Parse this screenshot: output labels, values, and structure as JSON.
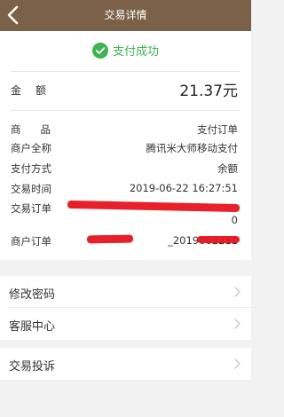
{
  "nav": {
    "title": "交易详情"
  },
  "status": {
    "text": "支付成功"
  },
  "amount": {
    "label": "金额",
    "value": "21.37元"
  },
  "details": {
    "product_label": "商品",
    "product_value": "支付订单",
    "merchant_label": "商户全称",
    "merchant_value": "腾讯米大师移动支付",
    "pay_method_label": "支付方式",
    "pay_method_value": "余额",
    "time_label": "交易时间",
    "time_value": "2019-06-22 16:27:51",
    "order_label": "交易订单",
    "order_value_tail": "0",
    "merchant_order_label": "商户订单",
    "merchant_order_value": "_2019062211"
  },
  "menu": {
    "change_password": "修改密码",
    "customer_service": "客服中心",
    "complaint": "交易投诉"
  },
  "colors": {
    "navbar": "#7a6147",
    "success": "#3fb34f",
    "redaction": "#e8141d"
  },
  "icons": {
    "back": "chevron-left-icon",
    "success": "check-circle-icon",
    "menu": "chevron-right-icon"
  }
}
